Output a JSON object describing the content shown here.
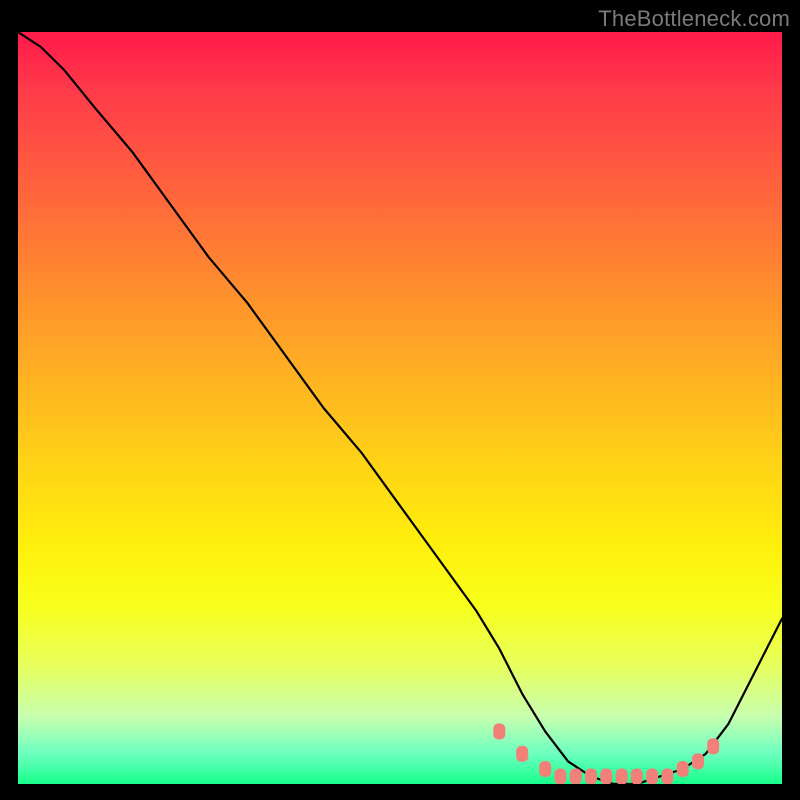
{
  "watermark": "TheBottleneck.com",
  "chart_data": {
    "type": "line",
    "title": "",
    "xlabel": "",
    "ylabel": "",
    "xlim": [
      0,
      100
    ],
    "ylim": [
      0,
      100
    ],
    "series": [
      {
        "name": "bottleneck-curve",
        "x": [
          0,
          3,
          6,
          10,
          15,
          20,
          25,
          30,
          35,
          40,
          45,
          50,
          55,
          60,
          63,
          66,
          69,
          72,
          75,
          78,
          81,
          84,
          87,
          90,
          93,
          96,
          100
        ],
        "values": [
          100,
          98,
          95,
          90,
          84,
          77,
          70,
          64,
          57,
          50,
          44,
          37,
          30,
          23,
          18,
          12,
          7,
          3,
          1,
          0,
          0,
          1,
          2,
          4,
          8,
          14,
          22
        ]
      }
    ],
    "markers": {
      "name": "dotted-band",
      "x": [
        63,
        66,
        69,
        71,
        73,
        75,
        77,
        79,
        81,
        83,
        85,
        87,
        89,
        91
      ],
      "values": [
        7,
        4,
        2,
        1,
        1,
        1,
        1,
        1,
        1,
        1,
        1,
        2,
        3,
        5
      ]
    },
    "background_gradient": {
      "stops": [
        {
          "pos": 0,
          "color": "#ff1a4a"
        },
        {
          "pos": 50,
          "color": "#ffc81a"
        },
        {
          "pos": 85,
          "color": "#f0ff40"
        },
        {
          "pos": 100,
          "color": "#18ff8a"
        }
      ]
    }
  }
}
